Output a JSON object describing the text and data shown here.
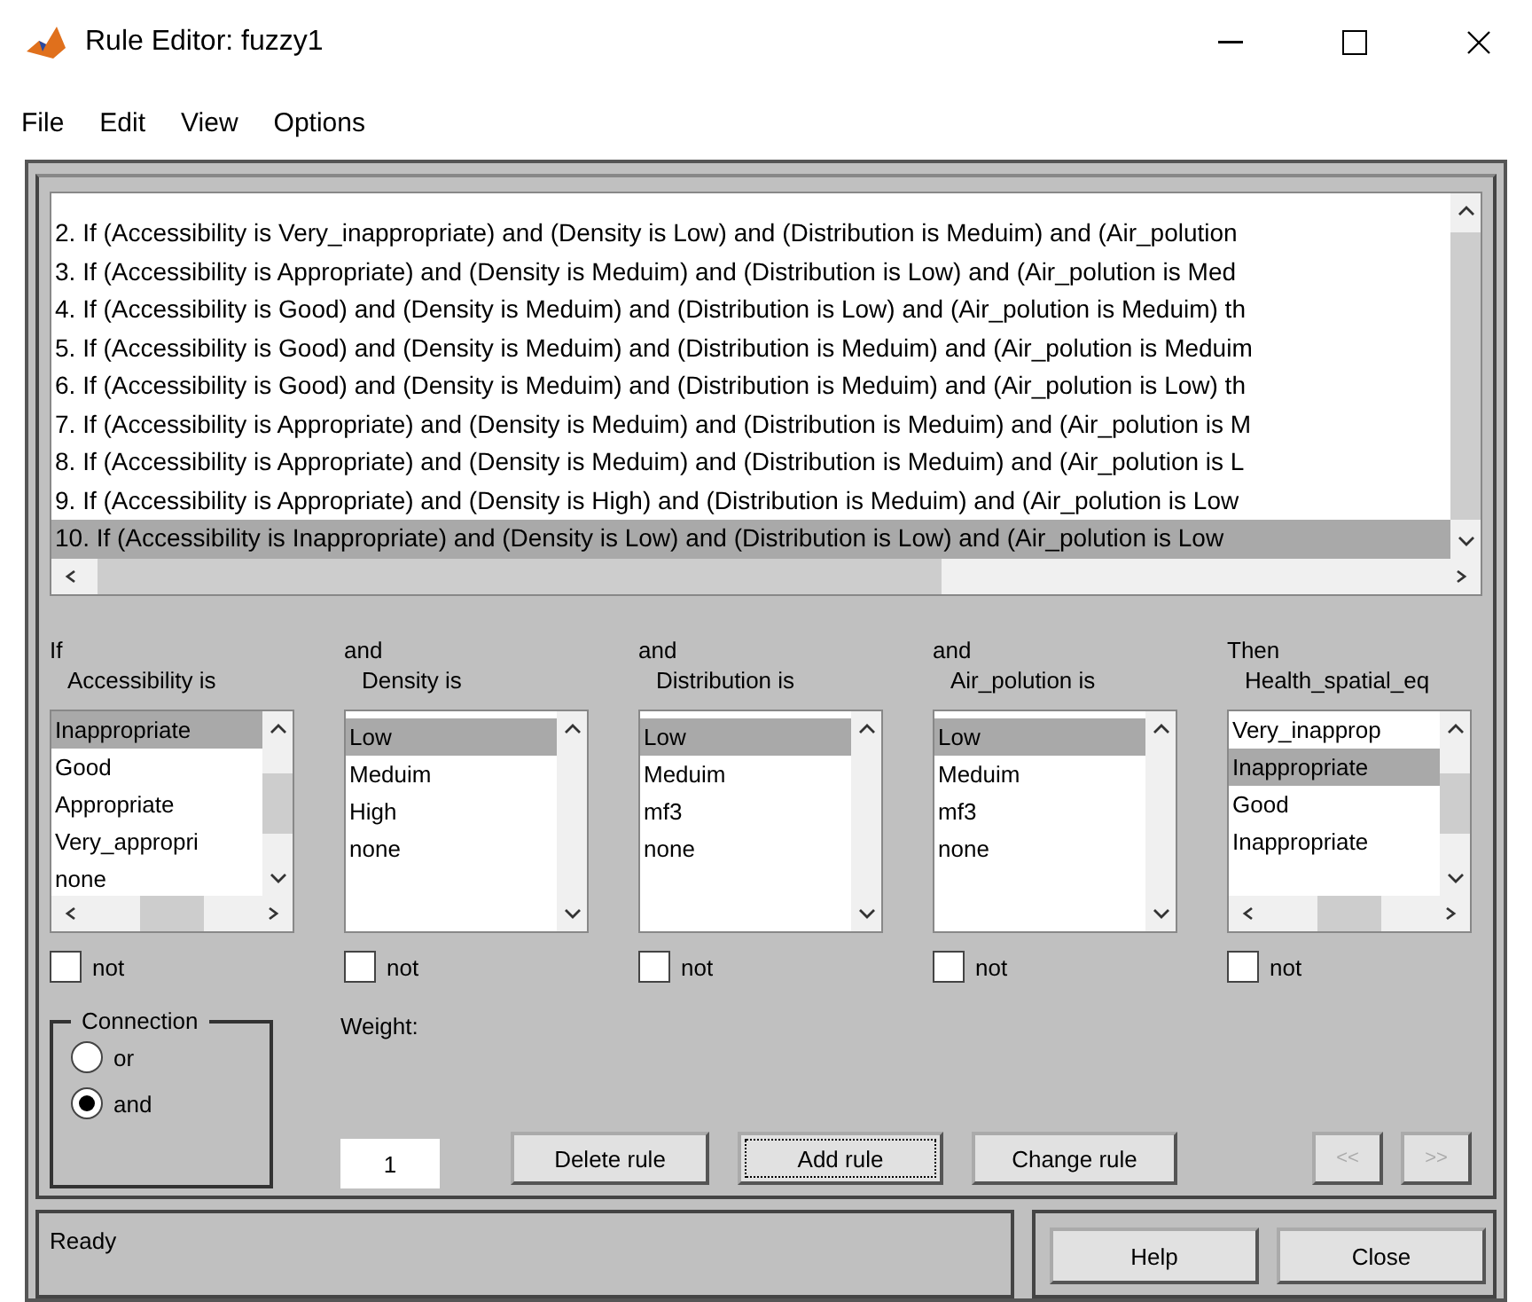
{
  "window": {
    "title": "Rule Editor: fuzzy1"
  },
  "menu": [
    "File",
    "Edit",
    "View",
    "Options"
  ],
  "rules": [
    {
      "text": "2. If (Accessibility is Very_inappropriate) and (Density is Low) and (Distribution is Meduim) and (Air_polution",
      "selected": false
    },
    {
      "text": "3. If (Accessibility is Appropriate) and (Density is Meduim) and (Distribution is Low) and (Air_polution is Med",
      "selected": false
    },
    {
      "text": "4. If (Accessibility is Good) and (Density is Meduim) and (Distribution is Low) and (Air_polution is Meduim) th",
      "selected": false
    },
    {
      "text": "5. If (Accessibility is Good) and (Density is Meduim) and (Distribution is Meduim) and (Air_polution is Meduim",
      "selected": false
    },
    {
      "text": "6. If (Accessibility is Good) and (Density is Meduim) and (Distribution is Meduim) and (Air_polution is Low) th",
      "selected": false
    },
    {
      "text": "7. If (Accessibility is Appropriate) and (Density is Meduim) and (Distribution is Meduim) and (Air_polution is M",
      "selected": false
    },
    {
      "text": "8. If (Accessibility is Appropriate) and (Density is Meduim) and (Distribution is Meduim) and (Air_polution is L",
      "selected": false
    },
    {
      "text": "9. If (Accessibility is Appropriate) and (Density is High) and (Distribution is Meduim) and (Air_polution is Low",
      "selected": false
    },
    {
      "text": "10. If (Accessibility is Inappropriate) and (Density is Low) and (Distribution is Low) and (Air_polution is Low",
      "selected": true
    }
  ],
  "variables": [
    {
      "connector": "If",
      "label": "Accessibility is",
      "hscroll": true,
      "not_label": "not",
      "not_checked": false,
      "options": [
        {
          "label": "Inappropriate",
          "selected": true
        },
        {
          "label": "Good",
          "selected": false
        },
        {
          "label": "Appropriate",
          "selected": false
        },
        {
          "label": "Very_appropri",
          "selected": false
        },
        {
          "label": "none",
          "selected": false
        }
      ]
    },
    {
      "connector": "and",
      "label": "Density is",
      "hscroll": false,
      "not_label": "not",
      "not_checked": false,
      "options": [
        {
          "label": "Low",
          "selected": true
        },
        {
          "label": "Meduim",
          "selected": false
        },
        {
          "label": "High",
          "selected": false
        },
        {
          "label": "none",
          "selected": false
        }
      ]
    },
    {
      "connector": "and",
      "label": "Distribution is",
      "hscroll": false,
      "not_label": "not",
      "not_checked": false,
      "options": [
        {
          "label": "Low",
          "selected": true
        },
        {
          "label": "Meduim",
          "selected": false
        },
        {
          "label": "mf3",
          "selected": false
        },
        {
          "label": "none",
          "selected": false
        }
      ]
    },
    {
      "connector": "and",
      "label": "Air_polution is",
      "hscroll": false,
      "not_label": "not",
      "not_checked": false,
      "options": [
        {
          "label": "Low",
          "selected": true
        },
        {
          "label": "Meduim",
          "selected": false
        },
        {
          "label": "mf3",
          "selected": false
        },
        {
          "label": "none",
          "selected": false
        }
      ]
    },
    {
      "connector": "Then",
      "label": "Health_spatial_eq",
      "hscroll": true,
      "not_label": "not",
      "not_checked": false,
      "options": [
        {
          "label": "Very_inapprop",
          "selected": false
        },
        {
          "label": "Inappropriate",
          "selected": true
        },
        {
          "label": "Good",
          "selected": false
        },
        {
          "label": "Inappropriate",
          "selected": false
        }
      ]
    }
  ],
  "connection": {
    "title": "Connection",
    "options": [
      {
        "label": "or",
        "selected": false
      },
      {
        "label": "and",
        "selected": true
      }
    ]
  },
  "weight": {
    "label": "Weight:",
    "value": "1"
  },
  "actions": [
    {
      "label": "Delete rule",
      "focused": false
    },
    {
      "label": "Add rule",
      "focused": true
    },
    {
      "label": "Change rule",
      "focused": false
    }
  ],
  "nav": [
    {
      "label": "<<",
      "disabled": true
    },
    {
      "label": ">>",
      "disabled": true
    }
  ],
  "status": "Ready",
  "footer_buttons": [
    "Help",
    "Close"
  ]
}
